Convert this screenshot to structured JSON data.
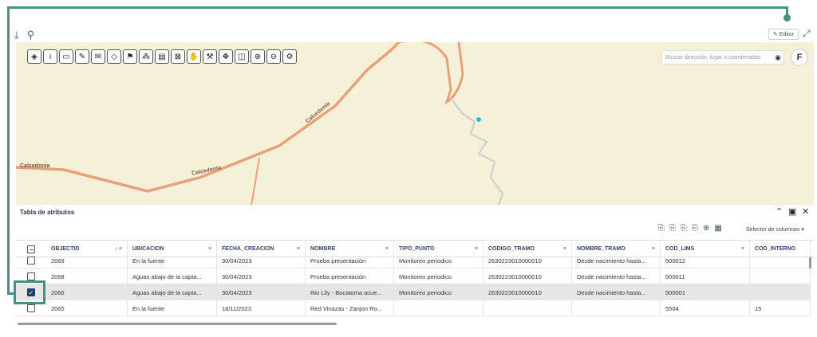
{
  "header": {
    "editor_label": "Editor"
  },
  "map": {
    "search_placeholder": "Buscar dirección, lugar o coordenadas",
    "f_button": "F",
    "road_labels": [
      "Calcedonia",
      "Calcedonia",
      "Calcedonia"
    ]
  },
  "table": {
    "title": "Tabla de atributos",
    "column_selector": "Selector de columnas",
    "columns": [
      "OBJECTID",
      "UBICACION",
      "FECHA_CREACION",
      "NOMBRE",
      "TIPO_PUNTO",
      "CODIGO_TRAMO",
      "NOMBRE_TRAMO",
      "COD_LIMS",
      "COD_INTERNO"
    ],
    "rows": [
      {
        "id": "2069",
        "ubicacion": "En la fuente",
        "fecha": "30/04/2023",
        "nombre": "Prueba presentación",
        "tipo": "Monitoreo periodico",
        "codigo": "2630223010000010",
        "tramo": "Desde nacimiento hasta...",
        "lims": "500012",
        "interno": "",
        "selected": false
      },
      {
        "id": "2068",
        "ubicacion": "Aguas abajo de la capta...",
        "fecha": "30/04/2023",
        "nombre": "Prueba presentación",
        "tipo": "Monitoreo periodico",
        "codigo": "2630223010000010",
        "tramo": "Desde nacimiento hasta...",
        "lims": "500011",
        "interno": "",
        "selected": false
      },
      {
        "id": "2066",
        "ubicacion": "Aguas abajo de la capta...",
        "fecha": "30/04/2023",
        "nombre": "Rio Lily - Bocatoma acue...",
        "tipo": "Monitoreo periodico",
        "codigo": "2630223010000010",
        "tramo": "Desde nacimiento hasta...",
        "lims": "500001",
        "interno": "",
        "selected": true
      },
      {
        "id": "2065",
        "ubicacion": "En la fuente",
        "fecha": "18/11/2023",
        "nombre": "Red Vinazas - Zanjon Ro...",
        "tipo": "",
        "codigo": "",
        "tramo": "",
        "lims": "5504",
        "interno": "15",
        "selected": false
      }
    ]
  },
  "colors": {
    "accent": "#4a8f86",
    "road": "#e8a07a",
    "map_bg": "#f4f1d8",
    "selected_row": "#e6e6e6"
  }
}
